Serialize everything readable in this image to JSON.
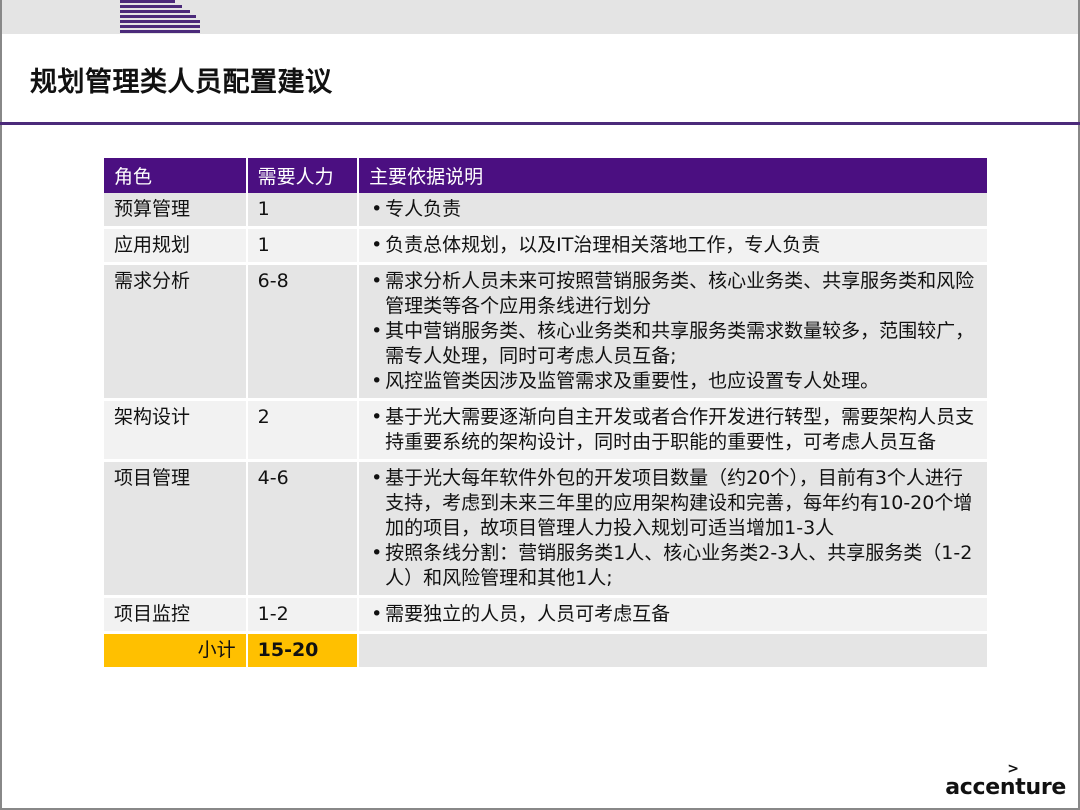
{
  "title": "规划管理类人员配置建议",
  "table": {
    "headers": [
      "角色",
      "需要人力",
      "主要依据说明"
    ],
    "rows": [
      {
        "role": "预算管理",
        "count": "1",
        "notes": [
          "专人负责"
        ]
      },
      {
        "role": "应用规划",
        "count": "1",
        "notes": [
          "负责总体规划，以及IT治理相关落地工作，专人负责"
        ]
      },
      {
        "role": "需求分析",
        "count": "6-8",
        "notes": [
          "需求分析人员未来可按照营销服务类、核心业务类、共享服务类和风险管理类等各个应用条线进行划分",
          "其中营销服务类、核心业务类和共享服务类需求数量较多，范围较广，需专人处理，同时可考虑人员互备;",
          "风控监管类因涉及监管需求及重要性，也应设置专人处理。"
        ]
      },
      {
        "role": "架构设计",
        "count": "2",
        "notes": [
          "基于光大需要逐渐向自主开发或者合作开发进行转型，需要架构人员支持重要系统的架构设计，同时由于职能的重要性，可考虑人员互备"
        ]
      },
      {
        "role": "项目管理",
        "count": "4-6",
        "notes": [
          "基于光大每年软件外包的开发项目数量（约20个），目前有3个人进行支持，考虑到未来三年里的应用架构建设和完善，每年约有10-20个增加的项目，故项目管理人力投入规划可适当增加1-3人",
          "按照条线分割：营销服务类1人、核心业务类2-3人、共享服务类（1-2人）和风险管理和其他1人;"
        ]
      },
      {
        "role": "项目监控",
        "count": "1-2",
        "notes": [
          "需要独立的人员，人员可考虑互备"
        ]
      }
    ],
    "total": {
      "label": "小计",
      "value": "15-20"
    }
  },
  "brand": {
    "name": "accenture",
    "mark": ">"
  },
  "colors": {
    "header_purple": "#4b0f81",
    "total_yellow": "#ffc000",
    "rule_purple": "#4b2a7a"
  }
}
